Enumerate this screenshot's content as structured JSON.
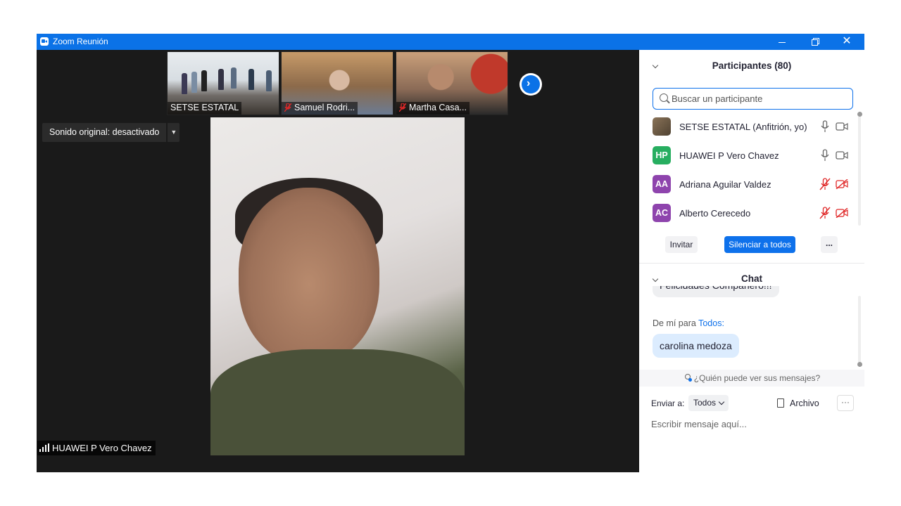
{
  "window": {
    "title": "Zoom Reunión",
    "controls": [
      "minimize-icon",
      "restore-icon",
      "close-icon"
    ],
    "accent_color": "#0b72e7"
  },
  "video": {
    "thumbnails": [
      {
        "name": "SETSE ESTATAL",
        "muted": false
      },
      {
        "name": "Samuel Rodri...",
        "muted": true
      },
      {
        "name": "Martha Casa...",
        "muted": true
      }
    ],
    "next_page_icon": "chevron-right-icon",
    "original_sound": {
      "label": "Sonido original: desactivado"
    },
    "active_speaker": "HUAWEI P Vero Chavez"
  },
  "participants": {
    "title": "Participantes (80)",
    "search_placeholder": "Buscar un participante",
    "list": [
      {
        "initials": "",
        "name": "SETSE ESTATAL (Anfitrión, yo)",
        "avatar_color": "#6b5a45",
        "mic": "on",
        "camera": "on"
      },
      {
        "initials": "HP",
        "name": "HUAWEI P Vero Chavez",
        "avatar_color": "#27ae60",
        "mic": "on",
        "camera": "on"
      },
      {
        "initials": "AA",
        "name": "Adriana Aguilar Valdez",
        "avatar_color": "#8e44ad",
        "mic": "off",
        "camera": "off"
      },
      {
        "initials": "AC",
        "name": "Alberto Cerecedo",
        "avatar_color": "#8e44ad",
        "mic": "off",
        "camera": "off"
      }
    ],
    "buttons": {
      "invite": "Invitar",
      "mute_all": "Silenciar a todos",
      "more": "..."
    }
  },
  "chat": {
    "title": "Chat",
    "messages": [
      {
        "text": "Felicidades Compañero!!!"
      },
      {
        "from": "De mí para",
        "to": "Todos:",
        "text": "carolina medoza"
      }
    ],
    "who_sees": "¿Quién puede ver sus mensajes?",
    "send_to_label": "Enviar a:",
    "send_to_value": "Todos",
    "file_label": "Archivo",
    "more_label": "···",
    "input_placeholder": "Escribir mensaje aquí..."
  }
}
